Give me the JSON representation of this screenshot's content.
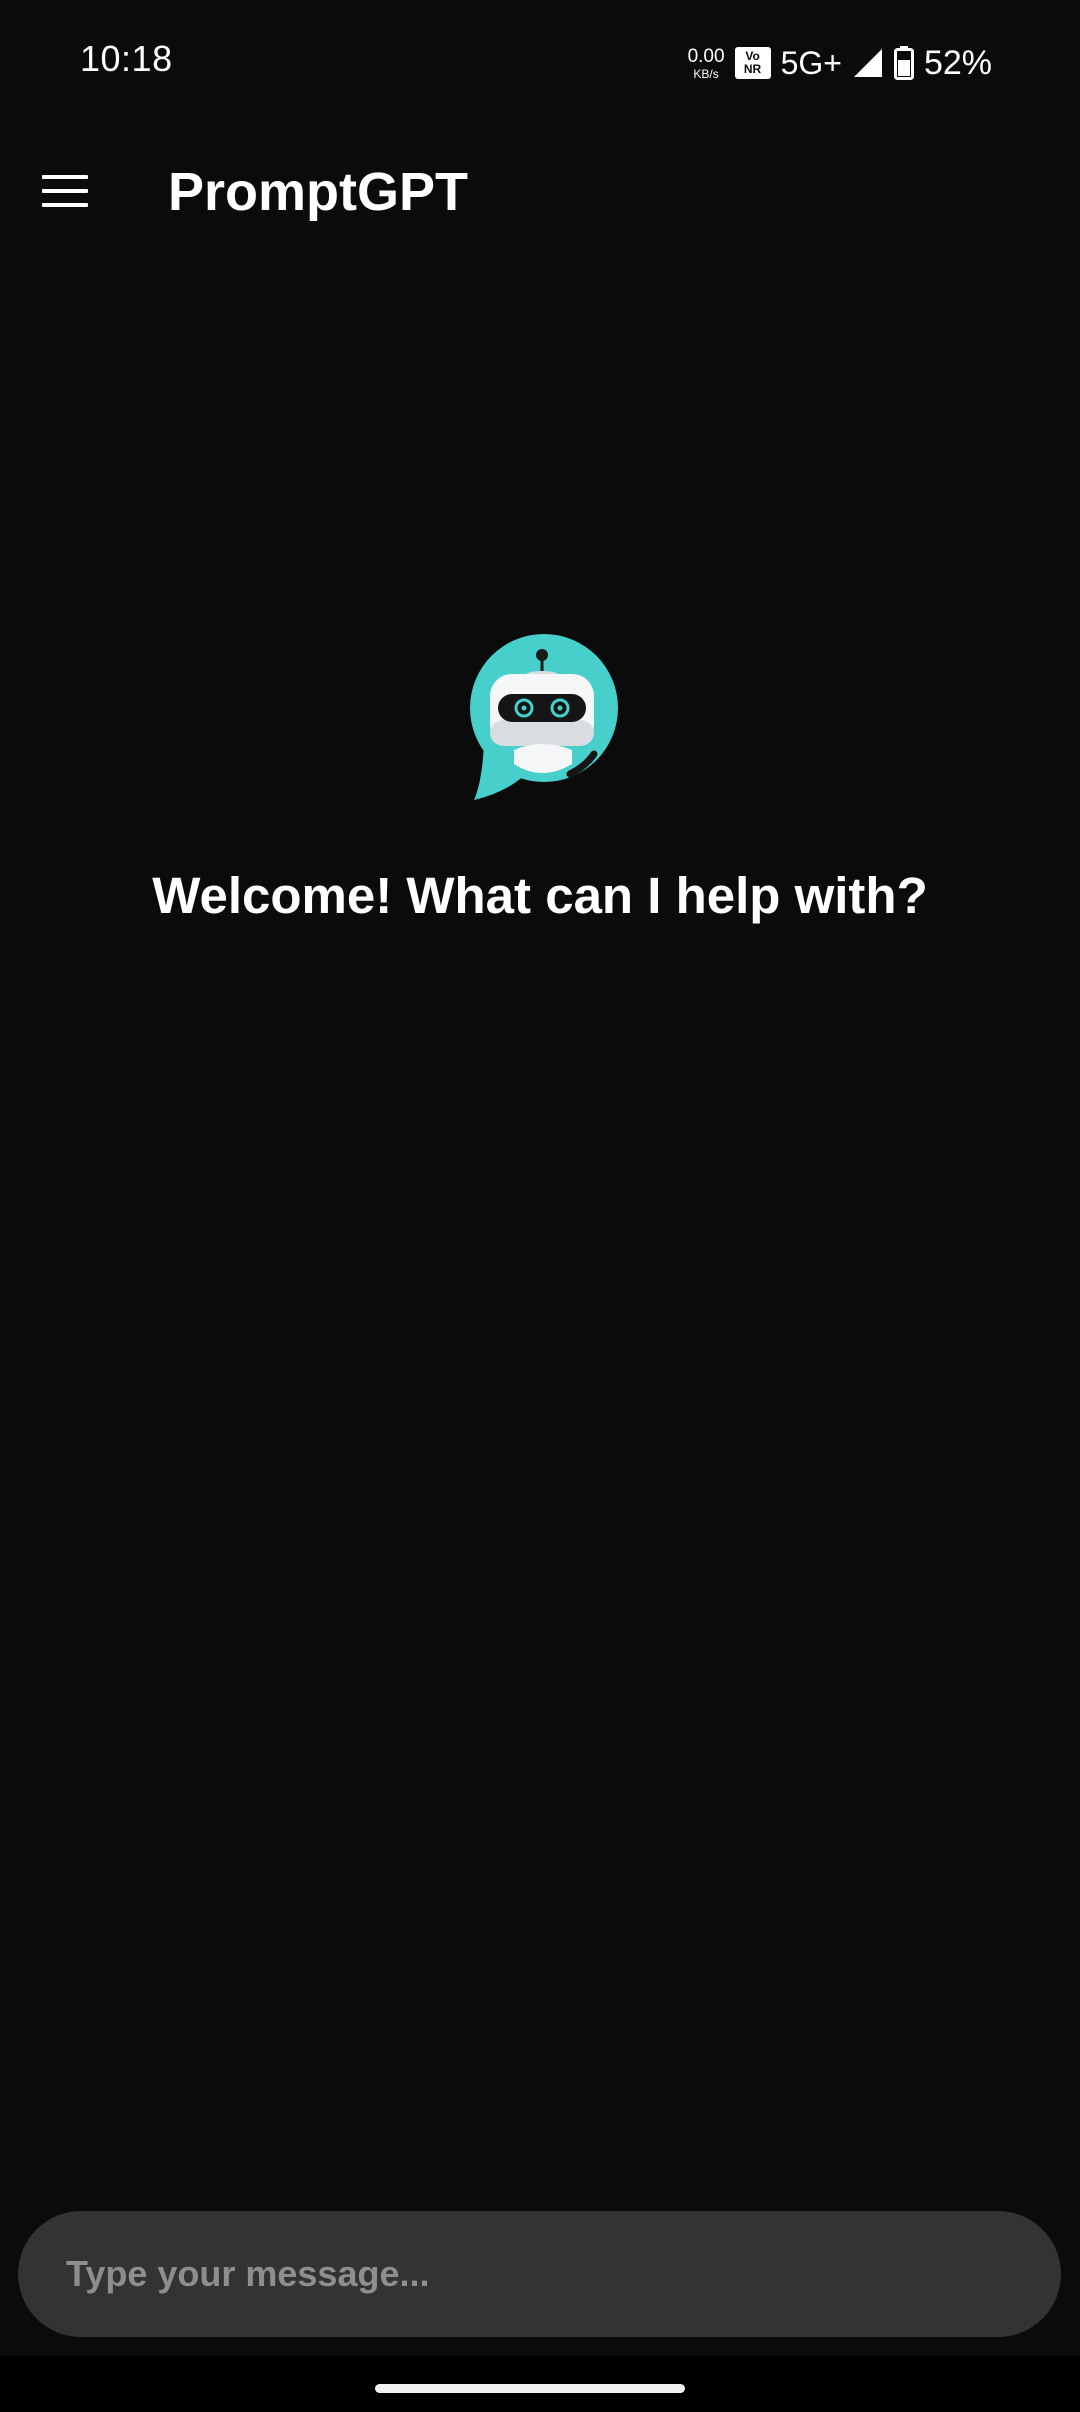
{
  "status_bar": {
    "time": "10:18",
    "net_speed_value": "0.00",
    "net_speed_unit": "KB/s",
    "volte_line1": "Vo",
    "volte_line2": "NR",
    "network_type": "5G+",
    "battery_percent": "52%",
    "icons": [
      "signal-icon",
      "battery-icon"
    ]
  },
  "app_bar": {
    "title": "PromptGPT",
    "menu_icon": "hamburger-menu-icon"
  },
  "main": {
    "logo_icon": "robot-chat-logo-icon",
    "welcome": "Welcome! What can I help with?"
  },
  "composer": {
    "placeholder": "Type your message...",
    "value": ""
  },
  "colors": {
    "background": "#0b0b0c",
    "input_bg": "#333333",
    "accent_teal": "#46cfcb",
    "placeholder": "#8e8e8e"
  }
}
